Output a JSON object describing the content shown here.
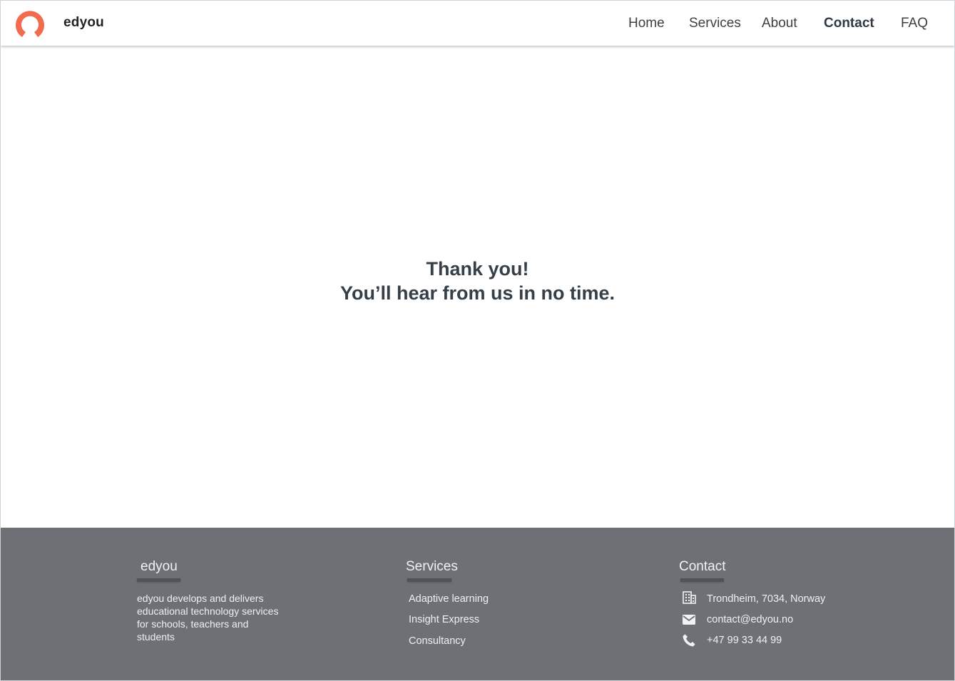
{
  "header": {
    "brand": "edyou",
    "nav": [
      {
        "label": "Home"
      },
      {
        "label": "Services"
      },
      {
        "label": "About"
      },
      {
        "label": "Contact"
      },
      {
        "label": "FAQ"
      }
    ],
    "active_nav": "Contact"
  },
  "main": {
    "line1": "Thank you!",
    "line2": "You’ll hear from us in no time."
  },
  "footer": {
    "about": {
      "title": "edyou",
      "text": "edyou develops and delivers educational technology services for schools, teachers and students"
    },
    "services": {
      "title": "Services",
      "links": [
        "Adaptive learning",
        "Insight Express",
        "Consultancy"
      ]
    },
    "contact": {
      "title": "Contact",
      "address": "Trondheim, 7034, Norway",
      "email": "contact@edyou.no",
      "phone": "+47 99 33 44 99",
      "icons": [
        "building-icon",
        "mail-icon",
        "phone-icon"
      ]
    }
  },
  "colors": {
    "brand_accent": "#f26b4f",
    "footer_bg": "#6d7075",
    "text_dark": "#343f48"
  }
}
